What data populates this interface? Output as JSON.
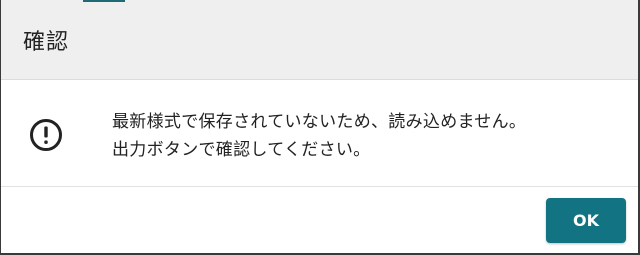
{
  "dialog": {
    "title": "確認",
    "icon": "alert-circle-icon",
    "message_lines": [
      "最新様式で保存されていないため、読み込めません。",
      "出力ボタンで確認してください。"
    ],
    "ok_label": "OK"
  },
  "colors": {
    "header_bg": "#efefef",
    "accent": "#127482",
    "text": "#222222"
  }
}
